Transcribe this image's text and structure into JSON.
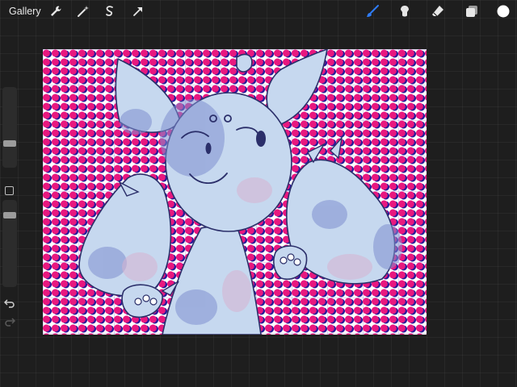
{
  "app": {
    "gallery_label": "Gallery"
  },
  "toolbar": {
    "left_icons": [
      "wrench-icon",
      "magic-wand-icon",
      "selection-icon",
      "transform-arrow-icon"
    ],
    "right_icons": [
      "brush-icon",
      "smudge-icon",
      "eraser-icon",
      "layers-icon",
      "color-swatch-icon"
    ],
    "accent_color": "#2f7cf6",
    "active_color": "#ffffff"
  },
  "sidebar": {
    "brush_size_slider_icon": "slider",
    "opacity_slider_icon": "slider",
    "modify_button_icon": "square-icon",
    "undo_icon": "undo-arrow-icon",
    "redo_icon": "redo-arrow-icon"
  },
  "canvas": {
    "background_pattern_colors": [
      "#e8187f",
      "#2a1a9a",
      "#ffffff"
    ],
    "character_fill": "#c6d8ef",
    "character_shade": "#7f8fd0",
    "character_outline": "#2b2f6a"
  }
}
